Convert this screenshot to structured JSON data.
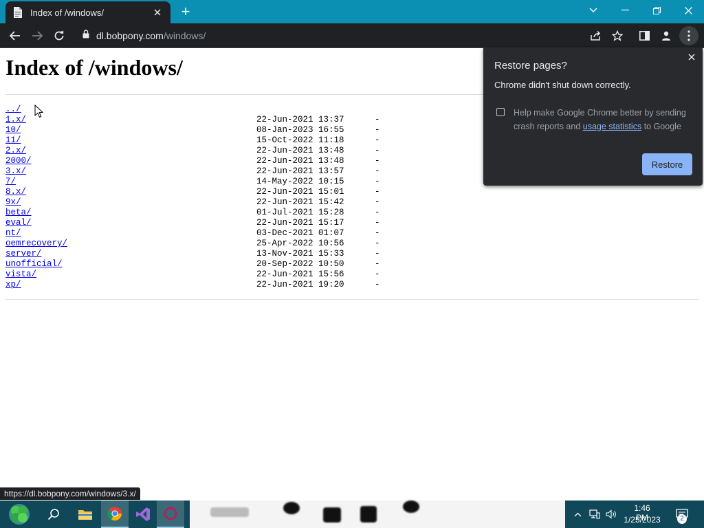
{
  "browser": {
    "tab_title": "Index of /windows/",
    "new_tab": "+",
    "url_host": "dl.bobpony.com",
    "url_path": "/windows/"
  },
  "page": {
    "heading": "Index of /windows/",
    "parent_link": "../",
    "entries": [
      {
        "name": "1.x/",
        "date": "22-Jun-2021 13:37",
        "size": "-"
      },
      {
        "name": "10/",
        "date": "08-Jan-2023 16:55",
        "size": "-"
      },
      {
        "name": "11/",
        "date": "15-Oct-2022 11:18",
        "size": "-"
      },
      {
        "name": "2.x/",
        "date": "22-Jun-2021 13:48",
        "size": "-"
      },
      {
        "name": "2000/",
        "date": "22-Jun-2021 13:48",
        "size": "-"
      },
      {
        "name": "3.x/",
        "date": "22-Jun-2021 13:57",
        "size": "-"
      },
      {
        "name": "7/",
        "date": "14-May-2022 10:15",
        "size": "-"
      },
      {
        "name": "8.x/",
        "date": "22-Jun-2021 15:01",
        "size": "-"
      },
      {
        "name": "9x/",
        "date": "22-Jun-2021 15:42",
        "size": "-"
      },
      {
        "name": "beta/",
        "date": "01-Jul-2021 15:28",
        "size": "-"
      },
      {
        "name": "eval/",
        "date": "22-Jun-2021 15:17",
        "size": "-"
      },
      {
        "name": "nt/",
        "date": "03-Dec-2021 01:07",
        "size": "-"
      },
      {
        "name": "oemrecovery/",
        "date": "25-Apr-2022 10:56",
        "size": "-"
      },
      {
        "name": "server/",
        "date": "13-Nov-2021 15:33",
        "size": "-"
      },
      {
        "name": "unofficial/",
        "date": "20-Sep-2022 10:50",
        "size": "-"
      },
      {
        "name": "vista/",
        "date": "22-Jun-2021 15:56",
        "size": "-"
      },
      {
        "name": "xp/",
        "date": "22-Jun-2021 19:20",
        "size": "-"
      }
    ]
  },
  "restore_popup": {
    "title": "Restore pages?",
    "message": "Chrome didn't shut down correctly.",
    "option_before": "Help make Google Chrome better by sending crash reports and ",
    "option_link": "usage statistics",
    "option_after": " to Google",
    "button": "Restore"
  },
  "status_bubble": "https://dl.bobpony.com/windows/3.x/",
  "taskbar": {
    "time": "1:46 PM",
    "date": "1/25/2023",
    "notifications": "2"
  },
  "colors": {
    "tab_strip": "#0b8fb3",
    "toolbar": "#202124",
    "link": "#0000ee",
    "accent_button": "#8ab4f8",
    "taskbar": "#10485a"
  }
}
